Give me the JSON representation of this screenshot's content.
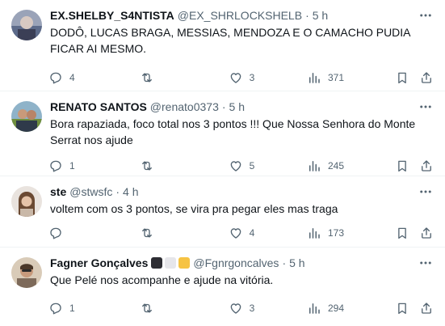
{
  "tweets": [
    {
      "name": "EX.SHELBY_S4NTISTA",
      "handle": "@EX_SHRLOCKSHELB",
      "time": "5 h",
      "text": "DODÔ, LUCAS BRAGA, MESSIAS, MENDOZA E O CAMACHO PUDIA FICAR AI MESMO.",
      "replies": "4",
      "retweets": "",
      "likes": "3",
      "views": "371"
    },
    {
      "name": "RENATO SANTOS",
      "handle": "@renato0373",
      "time": "5 h",
      "text": "Bora rapaziada, foco total nos 3 pontos !!! Que Nossa Senhora do Monte Serrat nos ajude",
      "replies": "1",
      "retweets": "",
      "likes": "5",
      "views": "245"
    },
    {
      "name": "ste",
      "handle": "@stwsfc",
      "time": "4 h",
      "text": "voltem com os 3 pontos, se vira pra pegar eles mas traga",
      "replies": "",
      "retweets": "",
      "likes": "4",
      "views": "173"
    },
    {
      "name": "Fagner Gonçalves",
      "handle": "@Fgnrgoncalves",
      "time": "5 h",
      "text": "Que Pelé nos acompanhe e ajude na vitória.",
      "badge_colors": [
        "#2d2d33",
        "#e6e6ea",
        "#f6c343"
      ],
      "replies": "1",
      "retweets": "",
      "likes": "3",
      "views": "294"
    }
  ],
  "separator": "·",
  "icons": [
    "more-icon",
    "reply-icon",
    "retweet-icon",
    "like-icon",
    "views-icon",
    "bookmark-icon",
    "share-icon"
  ],
  "colors": {
    "text": "#0f1419",
    "secondary": "#536471",
    "divider": "#eff3f4"
  }
}
